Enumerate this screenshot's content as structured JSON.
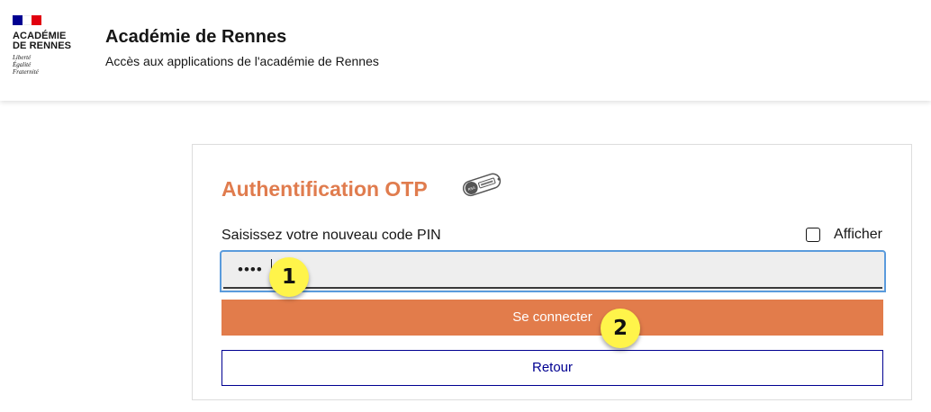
{
  "header": {
    "logo_lines": [
      "ACADÉMIE",
      "DE RENNES"
    ],
    "motto": [
      "Liberté",
      "Égalité",
      "Fraternité"
    ],
    "title": "Académie de Rennes",
    "subtitle": "Accès aux applications de l'académie de Rennes",
    "flag_colors": [
      "#000091",
      "#ffffff",
      "#e1000f"
    ]
  },
  "form": {
    "title": "Authentification OTP",
    "token_icon": "rsa-token-icon",
    "pin_label": "Saisissez votre nouveau code PIN",
    "show_label": "Afficher",
    "show_checked": false,
    "pin_value": "••••",
    "connect_label": "Se connecter",
    "back_label": "Retour",
    "colors": {
      "accent": "#e27c4b",
      "title": "#e07c4e",
      "back_border": "#000091",
      "focus": "#5a9bdc"
    }
  },
  "markers": [
    "1",
    "2"
  ]
}
